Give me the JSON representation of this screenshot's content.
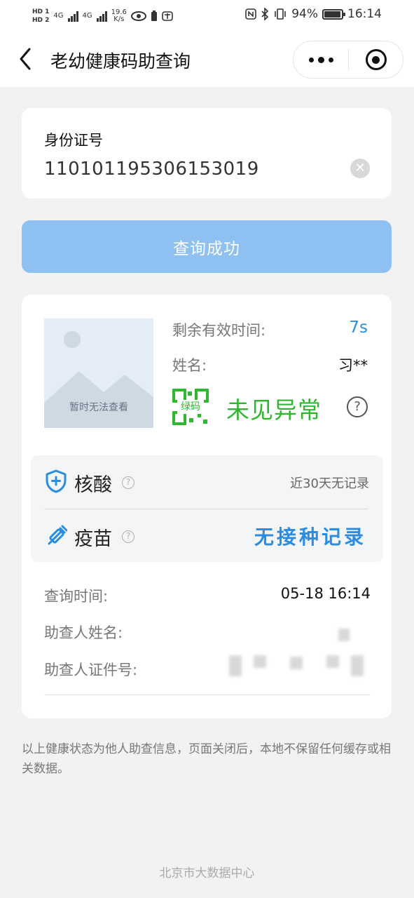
{
  "status_bar": {
    "hd1": "HD 1",
    "hd2": "HD 2",
    "net1": "4G",
    "net2": "4G",
    "speed_value": "19.6",
    "speed_unit": "K/s",
    "battery": "94%",
    "battery_level": 0.94,
    "time": "16:14"
  },
  "nav": {
    "title": "老幼健康码助查询"
  },
  "id_card": {
    "label": "身份证号",
    "value": "110101195306153019"
  },
  "query_button": {
    "label": "查询成功"
  },
  "result": {
    "photo_placeholder": "暂时无法查看",
    "remaining_label": "剩余有效时间:",
    "remaining_value": "7s",
    "name_label": "姓名:",
    "name_value": "习**",
    "qr_label": "绿码",
    "status_text": "未见异常",
    "nat_title": "核酸",
    "nat_status": "近30天无记录",
    "vaccine_title": "疫苗",
    "vaccine_status": "无接种记录",
    "query_time_label": "查询时间:",
    "query_time_value": "05-18 16:14",
    "helper_name_label": "助查人姓名:",
    "helper_id_label": "助查人证件号:"
  },
  "notice": "以上健康状态为他人助查信息，页面关闭后，本地不保留任何缓存或相关数据。",
  "footer": "北京市大数据中心",
  "colors": {
    "accent_blue": "#2b8de0",
    "button_blue": "#8ec1f2",
    "green": "#2fb82f",
    "background": "#f2f2f2"
  }
}
